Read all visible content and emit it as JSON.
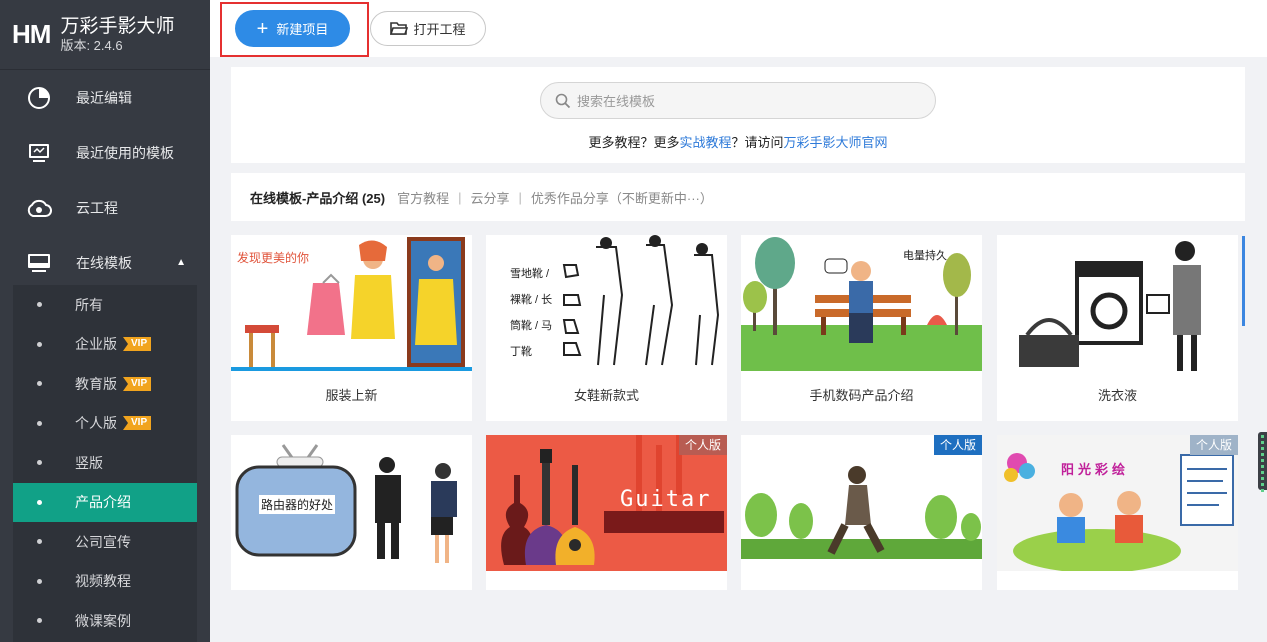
{
  "brand": {
    "logo": "HM",
    "name": "万彩手影大师",
    "version": "版本: 2.4.6"
  },
  "nav": [
    {
      "label": "最近编辑",
      "icon": "clock-pie-icon"
    },
    {
      "label": "最近使用的模板",
      "icon": "monitor-icon"
    },
    {
      "label": "云工程",
      "icon": "cloud-icon"
    },
    {
      "label": "在线模板",
      "icon": "screen-icon"
    }
  ],
  "subnav": [
    {
      "label": "所有",
      "vip": ""
    },
    {
      "label": "企业版",
      "vip": "VIP"
    },
    {
      "label": "教育版",
      "vip": "VIP"
    },
    {
      "label": "个人版",
      "vip": "VIP"
    },
    {
      "label": "竖版",
      "vip": ""
    },
    {
      "label": "产品介绍",
      "vip": "",
      "active": true
    },
    {
      "label": "公司宣传",
      "vip": ""
    },
    {
      "label": "视频教程",
      "vip": ""
    },
    {
      "label": "微课案例",
      "vip": ""
    }
  ],
  "toolbar": {
    "new_label": "新建项目",
    "open_label": "打开工程"
  },
  "search": {
    "placeholder": "搜索在线模板"
  },
  "help": {
    "p1": "更多教程？更多",
    "link1": "实战教程",
    "p2": "？请访问",
    "link2": "万彩手影大师官网"
  },
  "tabs": {
    "active": "在线模板-产品介绍 (25)",
    "t1": "官方教程",
    "t2": "云分享",
    "t3": "优秀作品分享（不断更新中···）",
    "sep": "|"
  },
  "cards": [
    {
      "title": "服装上新",
      "badge": "",
      "thumb_text": "发现更美的你"
    },
    {
      "title": "女鞋新款式",
      "badge": "",
      "thumb_text": "雪地靴 / 裸靴 / 长筒靴 / 马丁靴"
    },
    {
      "title": "手机数码产品介绍",
      "badge": "",
      "thumb_text": "电量持久"
    },
    {
      "title": "洗衣液",
      "badge": "",
      "thumb_text": ""
    },
    {
      "title": "",
      "badge": "",
      "thumb_text": "路由器的好处"
    },
    {
      "title": "",
      "badge": "个人版",
      "thumb_text": "Guitar"
    },
    {
      "title": "",
      "badge": "个人版",
      "thumb_text": ""
    },
    {
      "title": "",
      "badge": "个人版",
      "thumb_text": "阳光彩绘"
    }
  ],
  "colors": {
    "sidebar": "#363a42",
    "active": "#11a187",
    "accent": "#2e8be6",
    "vip": "#f1a41e",
    "highlight": "#e53030"
  }
}
